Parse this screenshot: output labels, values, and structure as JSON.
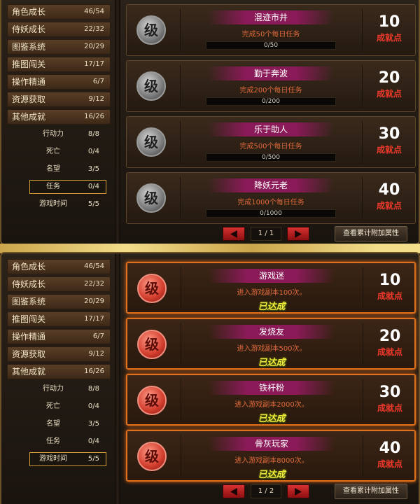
{
  "panels": [
    {
      "categories": [
        {
          "label": "角色成长",
          "count": "46/54"
        },
        {
          "label": "侍妖成长",
          "count": "22/32"
        },
        {
          "label": "图鉴系统",
          "count": "20/29"
        },
        {
          "label": "推图闯关",
          "count": "17/17"
        },
        {
          "label": "操作精通",
          "count": "6/7"
        },
        {
          "label": "资源获取",
          "count": "9/12"
        },
        {
          "label": "其他成就",
          "count": "16/26"
        }
      ],
      "subcategories": [
        {
          "label": "行动力",
          "count": "8/8",
          "selected": false
        },
        {
          "label": "死亡",
          "count": "0/4",
          "selected": false
        },
        {
          "label": "名望",
          "count": "3/5",
          "selected": false
        },
        {
          "label": "任务",
          "count": "0/4",
          "selected": true
        },
        {
          "label": "游戏时间",
          "count": "5/5",
          "selected": false
        }
      ],
      "cards": [
        {
          "emblem": "级",
          "title": "混迹市井",
          "desc": "完成50个每日任务",
          "progress": "0/50",
          "points": "10",
          "points_label": "成就点",
          "done": false
        },
        {
          "emblem": "级",
          "title": "勤于奔波",
          "desc": "完成200个每日任务",
          "progress": "0/200",
          "points": "20",
          "points_label": "成就点",
          "done": false
        },
        {
          "emblem": "级",
          "title": "乐于助人",
          "desc": "完成500个每日任务",
          "progress": "0/500",
          "points": "30",
          "points_label": "成就点",
          "done": false
        },
        {
          "emblem": "级",
          "title": "降妖元老",
          "desc": "完成1000个每日任务",
          "progress": "0/1000",
          "points": "40",
          "points_label": "成就点",
          "done": false
        }
      ],
      "page": "1 / 1",
      "attr_button": "查看累计附加属性"
    },
    {
      "categories": [
        {
          "label": "角色成长",
          "count": "46/54"
        },
        {
          "label": "侍妖成长",
          "count": "22/32"
        },
        {
          "label": "图鉴系统",
          "count": "20/29"
        },
        {
          "label": "推图闯关",
          "count": "17/17"
        },
        {
          "label": "操作精通",
          "count": "6/7"
        },
        {
          "label": "资源获取",
          "count": "9/12"
        },
        {
          "label": "其他成就",
          "count": "16/26"
        }
      ],
      "subcategories": [
        {
          "label": "行动力",
          "count": "8/8",
          "selected": false
        },
        {
          "label": "死亡",
          "count": "0/4",
          "selected": false
        },
        {
          "label": "名望",
          "count": "3/5",
          "selected": false
        },
        {
          "label": "任务",
          "count": "0/4",
          "selected": false
        },
        {
          "label": "游戏时间",
          "count": "5/5",
          "selected": true
        }
      ],
      "cards": [
        {
          "emblem": "级",
          "title": "游戏迷",
          "desc": "进入游戏副本100次。",
          "status": "已达成",
          "points": "10",
          "points_label": "成就点",
          "done": true
        },
        {
          "emblem": "级",
          "title": "发烧友",
          "desc": "进入游戏副本500次。",
          "status": "已达成",
          "points": "20",
          "points_label": "成就点",
          "done": true
        },
        {
          "emblem": "级",
          "title": "铁杆粉",
          "desc": "进入游戏副本2000次。",
          "status": "已达成",
          "points": "30",
          "points_label": "成就点",
          "done": true
        },
        {
          "emblem": "级",
          "title": "骨灰玩家",
          "desc": "进入游戏副本8000次。",
          "status": "已达成",
          "points": "40",
          "points_label": "成就点",
          "done": true
        }
      ],
      "page": "1 / 2",
      "attr_button": "查看累计附加属性"
    }
  ]
}
